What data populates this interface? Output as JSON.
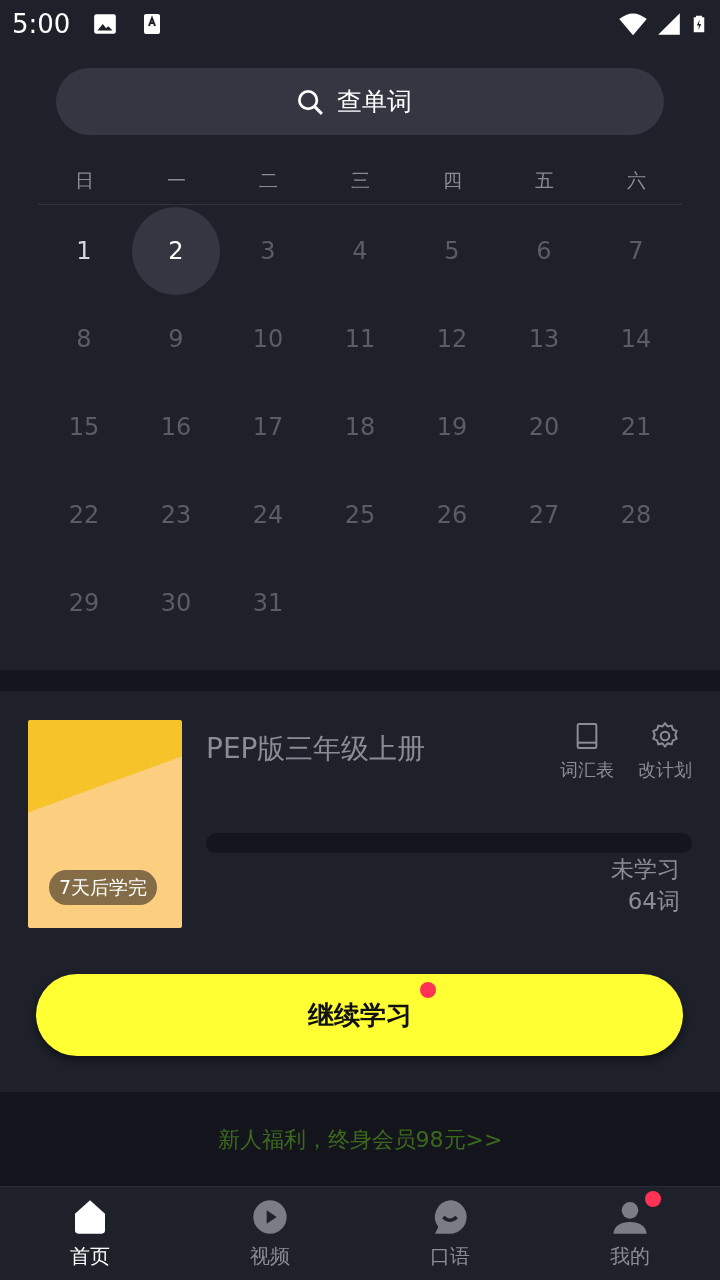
{
  "status_bar": {
    "time": "5:00"
  },
  "search": {
    "placeholder": "查单词"
  },
  "calendar": {
    "weekdays": [
      "日",
      "一",
      "二",
      "三",
      "四",
      "五",
      "六"
    ],
    "days": [
      {
        "label": "1",
        "selected": false,
        "active": true
      },
      {
        "label": "2",
        "selected": true,
        "active": true
      },
      {
        "label": "3",
        "selected": false,
        "active": false
      },
      {
        "label": "4",
        "selected": false,
        "active": false
      },
      {
        "label": "5",
        "selected": false,
        "active": false
      },
      {
        "label": "6",
        "selected": false,
        "active": false
      },
      {
        "label": "7",
        "selected": false,
        "active": false
      },
      {
        "label": "8",
        "selected": false,
        "active": false
      },
      {
        "label": "9",
        "selected": false,
        "active": false
      },
      {
        "label": "10",
        "selected": false,
        "active": false
      },
      {
        "label": "11",
        "selected": false,
        "active": false
      },
      {
        "label": "12",
        "selected": false,
        "active": false
      },
      {
        "label": "13",
        "selected": false,
        "active": false
      },
      {
        "label": "14",
        "selected": false,
        "active": false
      },
      {
        "label": "15",
        "selected": false,
        "active": false
      },
      {
        "label": "16",
        "selected": false,
        "active": false
      },
      {
        "label": "17",
        "selected": false,
        "active": false
      },
      {
        "label": "18",
        "selected": false,
        "active": false
      },
      {
        "label": "19",
        "selected": false,
        "active": false
      },
      {
        "label": "20",
        "selected": false,
        "active": false
      },
      {
        "label": "21",
        "selected": false,
        "active": false
      },
      {
        "label": "22",
        "selected": false,
        "active": false
      },
      {
        "label": "23",
        "selected": false,
        "active": false
      },
      {
        "label": "24",
        "selected": false,
        "active": false
      },
      {
        "label": "25",
        "selected": false,
        "active": false
      },
      {
        "label": "26",
        "selected": false,
        "active": false
      },
      {
        "label": "27",
        "selected": false,
        "active": false
      },
      {
        "label": "28",
        "selected": false,
        "active": false
      },
      {
        "label": "29",
        "selected": false,
        "active": false
      },
      {
        "label": "30",
        "selected": false,
        "active": false
      },
      {
        "label": "31",
        "selected": false,
        "active": false
      }
    ]
  },
  "book": {
    "badge": "7天后学完",
    "title": "PEP版三年级上册",
    "actions": [
      {
        "kind": "book",
        "label": "词汇表"
      },
      {
        "kind": "gear",
        "label": "改计划"
      }
    ],
    "progress": {
      "level": 0
    },
    "status": "未学习",
    "count": "64词",
    "continue_button": {
      "label": "继续学习",
      "badge": true
    }
  },
  "promo": "新人福利，终身会员98元>>",
  "tabs": [
    {
      "kind": "home",
      "label": "首页",
      "selected": true,
      "badge": false
    },
    {
      "kind": "video",
      "label": "视频",
      "selected": false,
      "badge": false
    },
    {
      "kind": "chat",
      "label": "口语",
      "selected": false,
      "badge": false
    },
    {
      "kind": "user",
      "label": "我的",
      "selected": false,
      "badge": true
    }
  ]
}
